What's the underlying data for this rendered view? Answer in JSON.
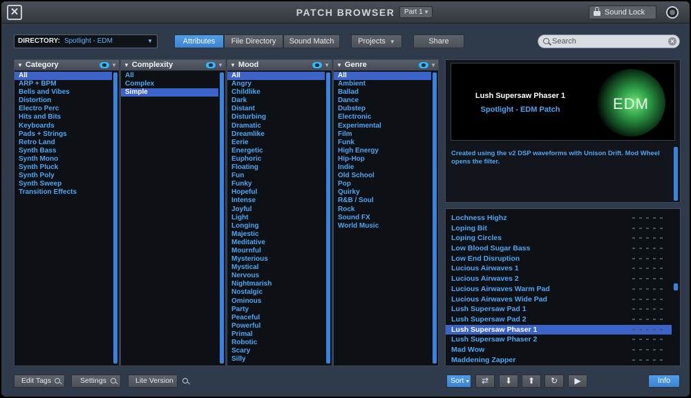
{
  "titlebar": {
    "title": "PATCH BROWSER",
    "part": "Part 1",
    "sound_lock": "Sound Lock"
  },
  "toolbar": {
    "directory_label": "DIRECTORY:",
    "directory_value": "Spotlight - EDM",
    "tabs": [
      "Attributes",
      "File Directory",
      "Sound Match"
    ],
    "active_tab": "Attributes",
    "projects": "Projects",
    "share": "Share",
    "search_placeholder": "Search"
  },
  "columns": {
    "category": {
      "title": "Category",
      "items": [
        "All",
        "ARP + BPM",
        "Bells and Vibes",
        "Distortion",
        "Electro Perc",
        "Hits and Bits",
        "Keyboards",
        "Pads + Strings",
        "Retro Land",
        "Synth Bass",
        "Synth Mono",
        "Synth Pluck",
        "Synth Poly",
        "Synth Sweep",
        "Transition Effects"
      ],
      "selected": 0
    },
    "complexity": {
      "title": "Complexity",
      "items": [
        "All",
        "Complex",
        "Simple"
      ],
      "selected": 2
    },
    "mood": {
      "title": "Mood",
      "items": [
        "All",
        "Angry",
        "Childlike",
        "Dark",
        "Distant",
        "Disturbing",
        "Dramatic",
        "Dreamlike",
        "Eerie",
        "Energetic",
        "Euphoric",
        "Floating",
        "Fun",
        "Funky",
        "Hopeful",
        "Intense",
        "Joyful",
        "Light",
        "Longing",
        "Majestic",
        "Meditative",
        "Mournful",
        "Mysterious",
        "Mystical",
        "Nervous",
        "Nightmarish",
        "Nostalgic",
        "Ominous",
        "Party",
        "Peaceful",
        "Powerful",
        "Primal",
        "Robotic",
        "Scary",
        "Silly"
      ],
      "selected": 0
    },
    "genre": {
      "title": "Genre",
      "items": [
        "All",
        "Ambient",
        "Ballad",
        "Dance",
        "Dubstep",
        "Electronic",
        "Experimental",
        "Film",
        "Funk",
        "High Energy",
        "Hip-Hop",
        "Indie",
        "Old School",
        "Pop",
        "Quirky",
        "R&B / Soul",
        "Rock",
        "Sound FX",
        "World Music"
      ],
      "selected": 0
    }
  },
  "info": {
    "patch_name": "Lush Supersaw Phaser 1",
    "patch_subtitle": "Spotlight - EDM Patch",
    "logo_text": "EDM",
    "description": "Created using the v2 DSP waveforms with Unison Drift. Mod Wheel opens the filter."
  },
  "patches": {
    "items": [
      "Lochness Highz",
      "Loping Bit",
      "Loping Circles",
      "Low Blood Sugar Bass",
      "Low End Disruption",
      "Lucious Airwaves 1",
      "Lucious Airwaves 2",
      "Lucious Airwaves Warm Pad",
      "Lucious Airwaves Wide Pad",
      "Lush Supersaw Pad 1",
      "Lush Supersaw Pad 2",
      "Lush Supersaw Phaser 1",
      "Lush Supersaw Phaser 2",
      "Mad Wow",
      "Maddening Zapper"
    ],
    "selected": 11
  },
  "bottom": {
    "edit_tags": "Edit Tags",
    "settings": "Settings",
    "lite_version": "Lite Version",
    "sort": "Sort",
    "info": "Info"
  },
  "colors": {
    "accent": "#3b84d4",
    "selection": "#3c64c8",
    "list_text": "#4ea6f2",
    "panel_bg": "#0d1116"
  }
}
